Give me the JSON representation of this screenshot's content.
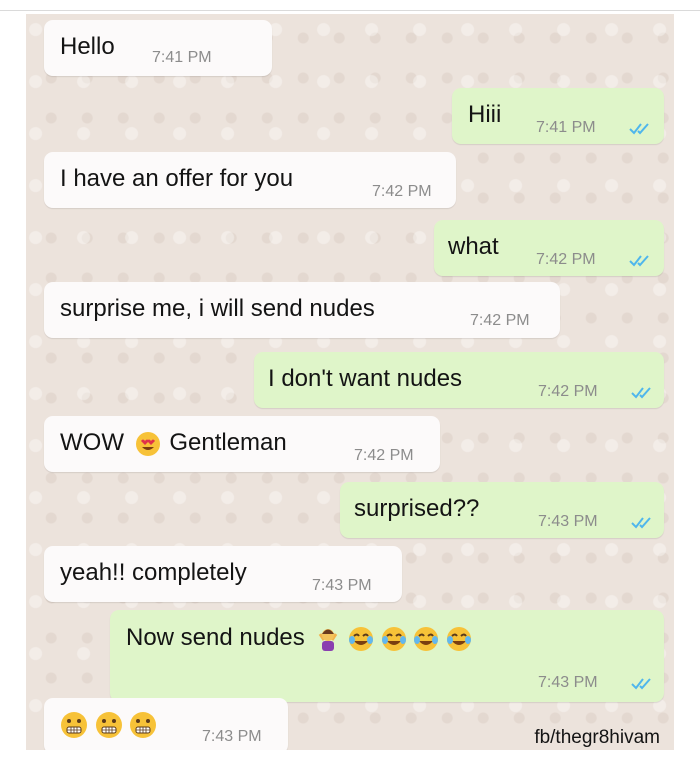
{
  "messages": [
    {
      "text": "Hello",
      "time": "7:41 PM"
    },
    {
      "text": "Hiii",
      "time": "7:41 PM"
    },
    {
      "text": "I have an offer for you",
      "time": "7:42 PM"
    },
    {
      "text": "what",
      "time": "7:42 PM"
    },
    {
      "text": "surprise me, i will send nudes",
      "time": "7:42 PM"
    },
    {
      "text": "I don't want nudes",
      "time": "7:42 PM"
    },
    {
      "text_before": "WOW",
      "text_after": "Gentleman",
      "emoji": "heart-eyes-face-emoji",
      "time": "7:42 PM"
    },
    {
      "text": "surprised??",
      "time": "7:43 PM"
    },
    {
      "text": "yeah!! completely",
      "time": "7:43 PM"
    },
    {
      "text": "Now send nudes",
      "emojis": [
        "woman-shrugging-emoji",
        "tears-of-joy-emoji",
        "tears-of-joy-emoji",
        "tears-of-joy-emoji",
        "tears-of-joy-emoji"
      ],
      "time": "7:43 PM"
    },
    {
      "emojis": [
        "grimacing-face-emoji",
        "grimacing-face-emoji",
        "grimacing-face-emoji"
      ],
      "time": "7:43 PM"
    }
  ],
  "credit": "fb/thegr8hivam",
  "colors": {
    "chat_background": "#ece3dc",
    "incoming_bubble": "#fcfafa",
    "outgoing_bubble": "#dff5c9",
    "read_ticks": "#4fb6ec",
    "timestamp": "#8c8c8c"
  }
}
